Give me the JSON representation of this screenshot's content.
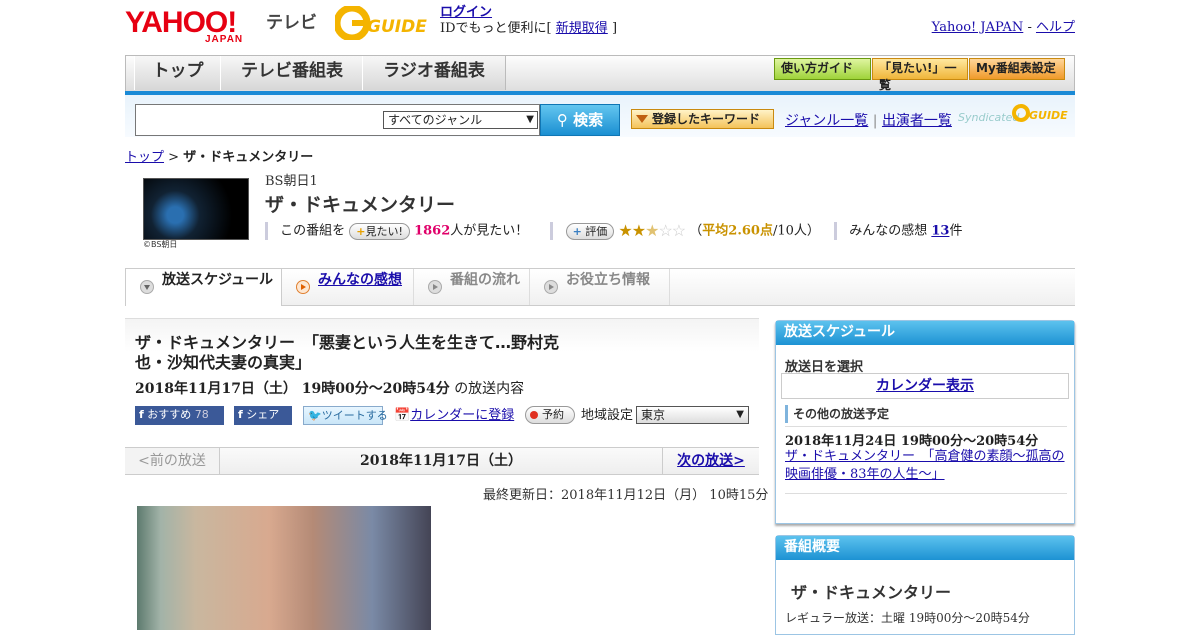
{
  "header": {
    "logo_main": "YAHOO!",
    "logo_sub": "JAPAN",
    "logo_tv": "テレビ",
    "login": "ログイン",
    "login_prompt": "IDでもっと便利に[",
    "register": "新規取得",
    "register_close": "]",
    "yahoo_japan": "Yahoo! JAPAN",
    "separator": "-",
    "help": "ヘルプ"
  },
  "nav": {
    "tabs": [
      "トップ",
      "テレビ番組表",
      "ラジオ番組表"
    ],
    "buttons": [
      "使い方ガイド",
      "「見たい!」一覧",
      "My番組表設定"
    ]
  },
  "search": {
    "input_value": "",
    "genre": "すべてのジャンル",
    "button": "検索",
    "keyword_button": "登録したキーワード",
    "genre_list": "ジャンル一覧",
    "link_sep": "|",
    "cast_list": "出演者一覧",
    "syndicated": "Syndicated"
  },
  "breadcrumb": {
    "home": "トップ",
    "sep": ">",
    "current": "ザ・ドキュメンタリー"
  },
  "program": {
    "thumb_caption": "©BS朝日",
    "channel": "BS朝日1",
    "title": "ザ・ドキュメンタリー",
    "want_prefix": "この番組を",
    "want_button": "見たい!",
    "want_count": "1862",
    "want_suffix": "人が見たい！",
    "rate_button": "評価",
    "rating": 2.6,
    "avg_open": "（",
    "avg_label": "平均2.60点",
    "avg_count": "/10人）",
    "reviews_label": "みんなの感想",
    "reviews_count": "13",
    "reviews_unit": "件"
  },
  "tabs": [
    "放送スケジュール",
    "みんなの感想",
    "番組の流れ",
    "お役立ち情報"
  ],
  "episode": {
    "title": "ザ・ドキュメンタリー　「悪妻という人生を生きて…野村克也・沙知代夫妻の真実」",
    "date": "2018年11月17日（土） 19時00分～20時54分",
    "date_suffix": "の放送内容",
    "recommend": "おすすめ",
    "recommend_count": "78",
    "share": "シェア",
    "tweet": "ツイートする",
    "calendar": "カレンダーに登録",
    "reserve": "予約",
    "region_label": "地域設定",
    "region": "東京"
  },
  "pager": {
    "prev": "<前の放送",
    "current": "2018年11月17日（土）",
    "next": "次の放送>"
  },
  "updated": "最終更新日：2018年11月12日（月） 10時15分",
  "sidebar": {
    "schedule_header": "放送スケジュール",
    "select_date": "放送日を選択",
    "calendar": "カレンダー表示",
    "other_header": "その他の放送予定",
    "other_date": "2018年11月24日 19時00分～20時54分",
    "other_title": "ザ・ドキュメンタリー　「高倉健の素顔～孤高の映画俳優・83年の人生～」",
    "overview_header": "番組概要",
    "overview_title": "ザ・ドキュメンタリー",
    "regular": "レギュラー放送：土曜 19時00分～20時54分"
  },
  "colors": {
    "accent": "#1a8ad6",
    "link": "#1a0dab",
    "brand": "#e60012",
    "star": "#c99200"
  }
}
